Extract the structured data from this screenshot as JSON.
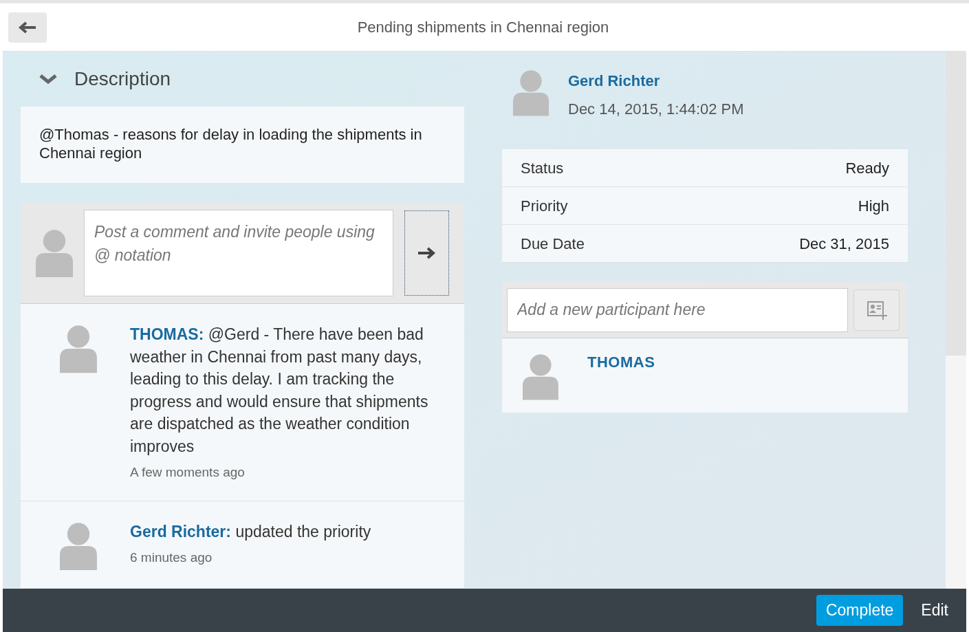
{
  "header": {
    "title": "Pending shipments in Chennai region"
  },
  "description": {
    "label": "Description",
    "expanded": true,
    "text": "@Thomas - reasons for delay in loading the shipments in Chennai region"
  },
  "comment_box": {
    "placeholder": "Post a comment and invite people using @ notation"
  },
  "feed": [
    {
      "author": "THOMAS:",
      "text": "@Gerd - There have been bad weather in Chennai from past many days, leading to this delay. I am tracking the progress and would ensure that shipments are dispatched as the weather condition improves",
      "time": "A few moments ago"
    },
    {
      "author": "Gerd Richter:",
      "text": "updated the priority",
      "time": "6 minutes ago"
    }
  ],
  "creator": {
    "name": "Gerd Richter",
    "date": "Dec 14, 2015, 1:44:02 PM"
  },
  "attributes": [
    {
      "label": "Status",
      "value": "Ready"
    },
    {
      "label": "Priority",
      "value": "High"
    },
    {
      "label": "Due Date",
      "value": "Dec 31, 2015"
    }
  ],
  "participant_field": {
    "placeholder": "Add a new participant here"
  },
  "participants": [
    {
      "name": "THOMAS"
    }
  ],
  "footer": {
    "buttons": [
      {
        "label": "Complete",
        "kind": "primary"
      },
      {
        "label": "Edit",
        "kind": "plain"
      }
    ]
  }
}
